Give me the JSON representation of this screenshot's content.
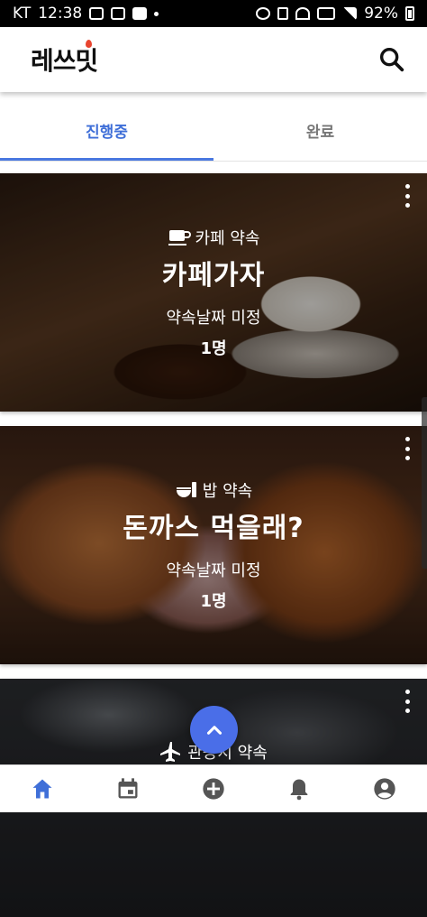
{
  "status_bar": {
    "carrier": "KT",
    "time": "12:38",
    "battery": "92%"
  },
  "app_bar": {
    "logo_text": "레쓰밋"
  },
  "tabs": [
    {
      "label": "진행중",
      "active": true
    },
    {
      "label": "완료",
      "active": false
    }
  ],
  "cards": [
    {
      "category": "카페 약속",
      "category_icon": "coffee-cup-icon",
      "title": "카페가자",
      "date": "약속날짜 미정",
      "count": "1명"
    },
    {
      "category": "밥 약속",
      "category_icon": "meal-icon",
      "title": "돈까스 먹을래?",
      "date": "약속날짜 미정",
      "count": "1명"
    },
    {
      "category": "관광지 약속",
      "category_icon": "airplane-icon",
      "title": "",
      "date": "",
      "count": ""
    }
  ],
  "colors": {
    "accent": "#3f6fd8",
    "fab": "#4a6ee8",
    "nav_active": "#3f6fd8",
    "nav_inactive": "#555555"
  },
  "bottom_nav": [
    {
      "icon": "home-icon",
      "active": true
    },
    {
      "icon": "calendar-icon",
      "active": false
    },
    {
      "icon": "add-circle-icon",
      "active": false
    },
    {
      "icon": "bell-icon",
      "active": false
    },
    {
      "icon": "account-icon",
      "active": false
    }
  ]
}
